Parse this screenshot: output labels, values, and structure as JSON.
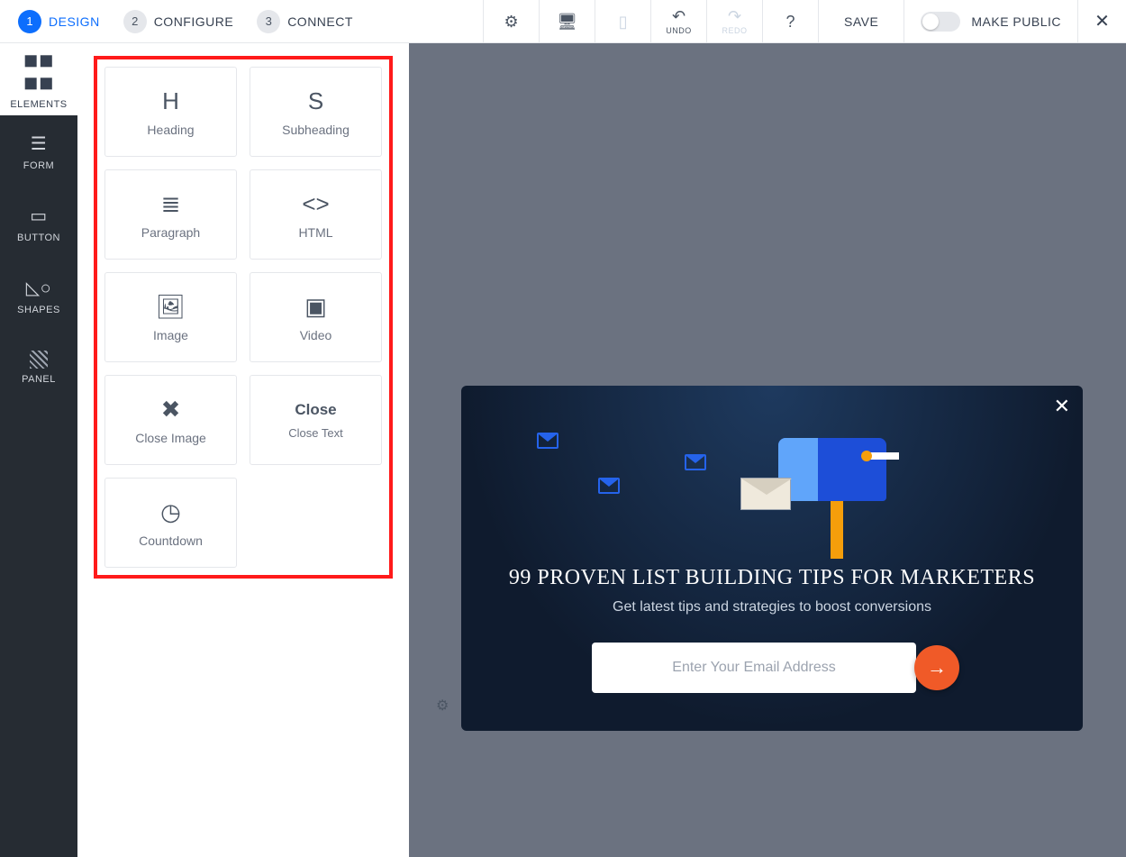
{
  "steps": [
    {
      "num": "1",
      "label": "DESIGN"
    },
    {
      "num": "2",
      "label": "CONFIGURE"
    },
    {
      "num": "3",
      "label": "CONNECT"
    }
  ],
  "toolbar": {
    "undo": "UNDO",
    "redo": "REDO",
    "save": "SAVE",
    "make_public": "MAKE PUBLIC"
  },
  "sidebar": [
    {
      "label": "ELEMENTS"
    },
    {
      "label": "FORM"
    },
    {
      "label": "BUTTON"
    },
    {
      "label": "SHAPES"
    },
    {
      "label": "PANEL"
    }
  ],
  "elements": [
    {
      "icon": "H",
      "label": "Heading"
    },
    {
      "icon": "S",
      "label": "Subheading"
    },
    {
      "icon": "≣",
      "label": "Paragraph"
    },
    {
      "icon": "<>",
      "label": "HTML"
    },
    {
      "icon": "🖼",
      "label": "Image"
    },
    {
      "icon": "▣",
      "label": "Video"
    },
    {
      "icon": "✖",
      "label": "Close Image"
    },
    {
      "icon": "Close",
      "label": "Close Text",
      "textIcon": true
    },
    {
      "icon": "◷",
      "label": "Countdown"
    }
  ],
  "popup": {
    "heading": "99 PROVEN LIST BUILDING TIPS FOR MARKETERS",
    "sub": "Get latest tips and strategies to boost conversions",
    "placeholder": "Enter Your Email Address"
  }
}
